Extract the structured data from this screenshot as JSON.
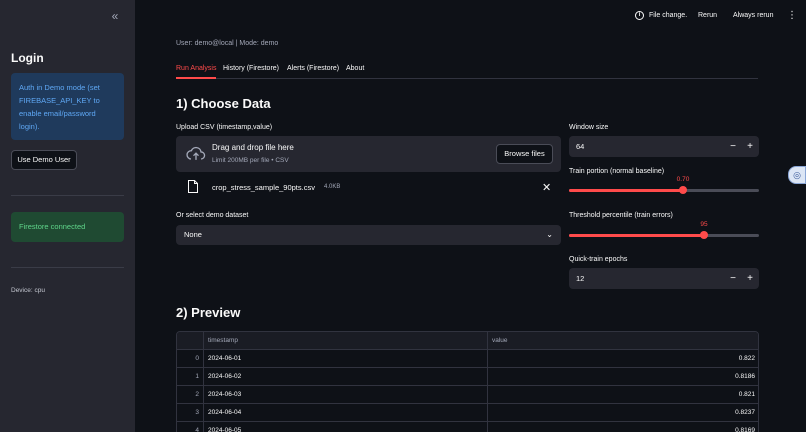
{
  "sidebar": {
    "collapse_icon": "double-chevron-left-icon",
    "title": "Login",
    "info_text": "Auth in Demo mode (set FIREBASE_API_KEY to enable email/password login).",
    "demo_button": "Use Demo User",
    "firestore_status": "Firestore connected",
    "device": "Device: cpu"
  },
  "topbar": {
    "file_change": "File change.",
    "rerun": "Rerun",
    "always_rerun": "Always rerun"
  },
  "main": {
    "user_line": "User: demo@local | Mode: demo",
    "tabs": [
      {
        "label": "Run Analysis",
        "active": true
      },
      {
        "label": "History (Firestore)",
        "active": false
      },
      {
        "label": "Alerts (Firestore)",
        "active": false
      },
      {
        "label": "About",
        "active": false
      }
    ],
    "section1_title": "1) Choose Data",
    "upload_label": "Upload CSV (timestamp,value)",
    "dropzone_title": "Drag and drop file here",
    "dropzone_sub": "Limit 200MB per file • CSV",
    "browse_button": "Browse files",
    "file_name": "crop_stress_sample_90pts.csv",
    "file_size": "4.0KB",
    "demo_label": "Or select demo dataset",
    "demo_value": "None",
    "window_label": "Window size",
    "window_value": "64",
    "train_label": "Train portion (normal baseline)",
    "train_value": "0.70",
    "train_fraction": 0.6,
    "threshold_label": "Threshold percentile (train errors)",
    "threshold_value": "95",
    "threshold_fraction": 0.71,
    "epochs_label": "Quick-train epochs",
    "epochs_value": "12",
    "section2_title": "2) Preview",
    "table": {
      "headers": [
        "",
        "timestamp",
        "value"
      ],
      "rows": [
        [
          "0",
          "2024-06-01",
          "0.822"
        ],
        [
          "1",
          "2024-06-02",
          "0.8186"
        ],
        [
          "2",
          "2024-06-03",
          "0.821"
        ],
        [
          "3",
          "2024-06-04",
          "0.8237"
        ],
        [
          "4",
          "2024-06-05",
          "0.8169"
        ]
      ]
    }
  },
  "colors": {
    "accent": "#ff4b4b",
    "background": "#0e1117",
    "sidebar": "#262730"
  }
}
